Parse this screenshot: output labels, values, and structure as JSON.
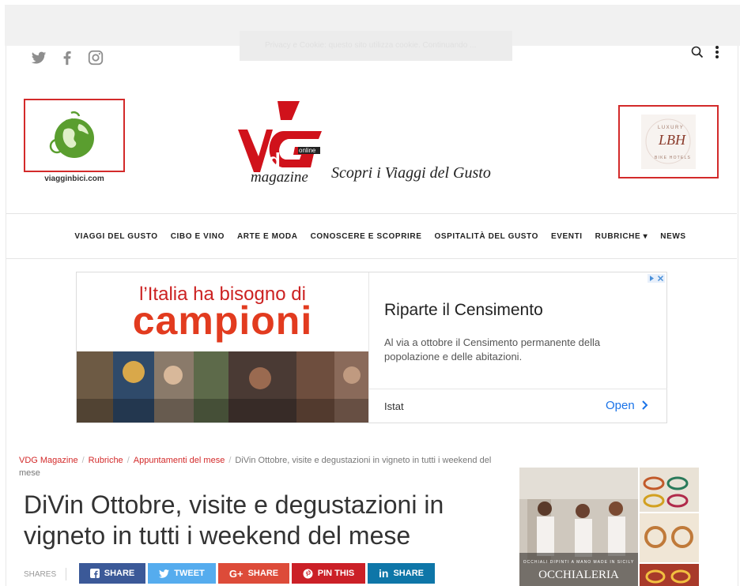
{
  "cookie_notice": "Privacy e Cookie: questo sito utilizza cookie. Continuando ...",
  "header": {
    "social_icons": [
      "twitter-icon",
      "facebook-icon",
      "instagram-icon"
    ],
    "search_icon": "search-icon",
    "menu_icon": "more-vertical-icon",
    "left_logo_text": "viagginbici.com",
    "right_logo_text": "LUXURY BIKE HOTELS",
    "right_logo_mark": "LBH",
    "brand_online": "online",
    "brand_magazine": "magazine",
    "tagline": "Scopri i Viaggi del Gusto"
  },
  "nav": {
    "items": [
      {
        "label": "VIAGGI DEL GUSTO"
      },
      {
        "label": "CIBO E VINO"
      },
      {
        "label": "ARTE E MODA"
      },
      {
        "label": "CONOSCERE E SCOPRIRE"
      },
      {
        "label": "OSPITALITÀ DEL GUSTO"
      },
      {
        "label": "EVENTI"
      },
      {
        "label": "RUBRICHE ▾"
      },
      {
        "label": "NEWS"
      }
    ]
  },
  "ad": {
    "headline_small": "l’Italia ha bisogno di",
    "headline_big": "campioni",
    "title": "Riparte il Censimento",
    "description": "Al via a ottobre il Censimento permanente della popolazione e delle abitazioni.",
    "sponsor": "Istat",
    "cta": "Open",
    "accent_color": "#e23b1f",
    "link_color": "#1a73e8"
  },
  "breadcrumb": {
    "items": [
      "VDG Magazine",
      "Rubriche",
      "Appuntamenti del mese"
    ],
    "current": "DiVin Ottobre, visite e degustazioni in vigneto in tutti i weekend del mese"
  },
  "article": {
    "title": "DiVin Ottobre, visite e degustazioni in vigneto in tutti i weekend del mese"
  },
  "shares": {
    "label": "SHARES",
    "buttons": [
      {
        "label": "SHARE",
        "icon": "facebook-icon",
        "color": "#3b5998"
      },
      {
        "label": "TWEET",
        "icon": "twitter-icon",
        "color": "#55acee"
      },
      {
        "label": "SHARE",
        "icon": "google-plus-icon",
        "color": "#dd4b39"
      },
      {
        "label": "PIN THIS",
        "icon": "pinterest-icon",
        "color": "#cb2027"
      },
      {
        "label": "SHARE",
        "icon": "linkedin-icon",
        "color": "#0e76a8"
      }
    ]
  },
  "sidebar_ad": {
    "small_caption": "OCCHIALI DIPINTI A MANO MADE IN SICILY",
    "big_caption": "OCCHIALERIA"
  }
}
